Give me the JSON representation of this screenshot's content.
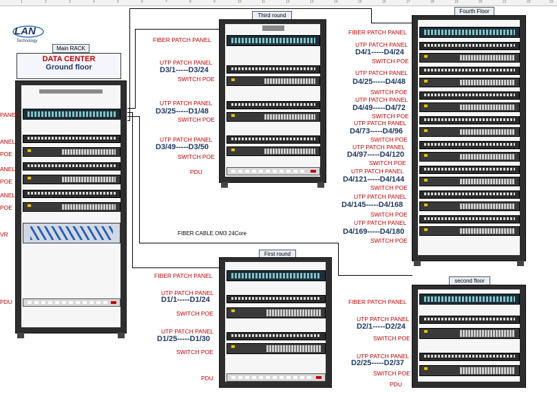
{
  "ruler_ticks": [
    "1",
    "2",
    "3",
    "4",
    "5",
    "6",
    "7",
    "8",
    "9",
    "10",
    "11",
    "12",
    "13",
    "14",
    "15",
    "16",
    "17",
    "18",
    "19",
    "20",
    "21",
    "22",
    "23"
  ],
  "logo": {
    "text": "LAN",
    "sub": "Technology"
  },
  "main_rack": {
    "title": "Main RACK",
    "banner_line1": "DATA CENTER",
    "banner_line2": "Ground floor",
    "left_labels": [
      "PANEL",
      "ANEL",
      "POE",
      "ANEL",
      "POE",
      "ANEL",
      "POE",
      "VR",
      "PDU"
    ]
  },
  "cable_label": "FIBER CABLE OM3 24Core",
  "third_round": {
    "title": "Third round",
    "fiber": "FIBER  PATCH PANEL",
    "blocks": [
      {
        "utp": "UTP PATCH PANEL",
        "range": "D3/1-----D3/24",
        "poe": "SWITCH POE"
      },
      {
        "utp": "UTP PATCH PANEL",
        "range": "D3/25-----D1/48",
        "poe": "SWITCH POE"
      },
      {
        "utp": "UTP PATCH PANEL",
        "range": "D3/49-----D3/50",
        "poe": "SWITCH POE"
      }
    ],
    "pdu": "PDU"
  },
  "first_round": {
    "title": "First round",
    "fiber": "FIBER  PATCH PANEL",
    "blocks": [
      {
        "utp": "UTP PATCH PANEL",
        "range": "D1/1-----D1/24",
        "poe": "SWITCH POE"
      },
      {
        "utp": "UTP PATCH PANEL",
        "range": "D1/25-----D1/30",
        "poe": "SWITCH POE"
      }
    ],
    "pdu": "PDU"
  },
  "fourth_floor": {
    "title": "Fourth Floor",
    "fiber": "FIBER  PATCH PANEL",
    "blocks": [
      {
        "utp": "UTP PATCH PANEL",
        "range": "D4/1-----D4/24",
        "poe": "SWITCH POE"
      },
      {
        "utp": "UTP PATCH PANEL",
        "range": "D4/25-----D4/48",
        "poe": "SWITCH POE"
      },
      {
        "utp": "UTP PATCH PANEL",
        "range": "D4/49-----D4/72",
        "poe": "SWITCH POE"
      },
      {
        "utp": "UTP PATCH PANEL",
        "range": "D4/73-----D4/96",
        "poe": "SWITCH POE"
      },
      {
        "utp": "UTP PATCH PANEL",
        "range": "D4/97-----D4/120",
        "poe": "SWITCH POE"
      },
      {
        "utp": "UTP PATCH PANEL",
        "range": "D4/121-----D4/144",
        "poe": "SWITCH POE"
      },
      {
        "utp": "UTP PATCH PANEL",
        "range": "D4/145-----D4/168",
        "poe": "SWITCH POE"
      },
      {
        "utp": "UTP PATCH PANEL",
        "range": "D4/169-----D4/180",
        "poe": "SWITCH POE"
      }
    ]
  },
  "second_floor": {
    "title": "second floor",
    "fiber": "FIBER  PATCH PANEL",
    "blocks": [
      {
        "utp": "UTP PATCH PANEL",
        "range": "D2/1-----D2/24",
        "poe": "SWITCH POE"
      },
      {
        "utp": "UTP PATCH PANEL",
        "range": "D2/25-----D2/37",
        "poe": "SWITCH POE"
      }
    ],
    "pdu": "PDU"
  },
  "colors": {
    "label_red": "#c00000",
    "range_navy": "#1f3864",
    "rack_dark": "#2e2e2e"
  }
}
